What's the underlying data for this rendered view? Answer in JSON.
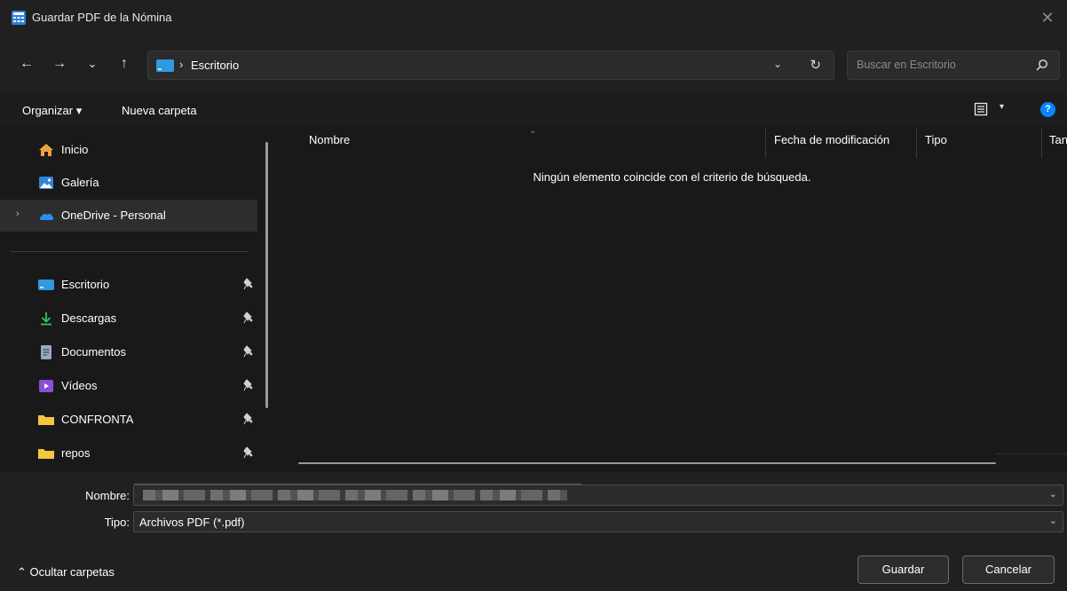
{
  "window": {
    "title": "Guardar PDF de la Nómina",
    "close_glyph": "✕"
  },
  "nav": {
    "back_glyph": "←",
    "forward_glyph": "→",
    "recent_glyph": "⌄",
    "up_glyph": "↑",
    "address_separator": "›",
    "address_path": "Escritorio",
    "address_dropdown_glyph": "⌄",
    "refresh_glyph": "↻",
    "search_placeholder": "Buscar en Escritorio"
  },
  "commands": {
    "organize": "Organizar ▾",
    "new_folder": "Nueva carpeta",
    "view_caret": "▾",
    "help": "?"
  },
  "sidebar": {
    "items": [
      {
        "label": "Inicio",
        "icon": "home-icon"
      },
      {
        "label": "Galería",
        "icon": "gallery-icon"
      },
      {
        "label": "OneDrive - Personal",
        "icon": "onedrive-icon",
        "expand_glyph": "›",
        "selected": true
      },
      {
        "label": "Escritorio",
        "icon": "desktop-folder-icon",
        "pinned": true
      },
      {
        "label": "Descargas",
        "icon": "download-icon",
        "pinned": true
      },
      {
        "label": "Documentos",
        "icon": "documents-icon",
        "pinned": true
      },
      {
        "label": "Vídeos",
        "icon": "videos-icon",
        "pinned": true
      },
      {
        "label": "CONFRONTA",
        "icon": "folder-icon",
        "pinned": true
      },
      {
        "label": "repos",
        "icon": "folder-icon",
        "pinned": true
      }
    ]
  },
  "filelist": {
    "columns": [
      "Nombre",
      "Fecha de modificación",
      "Tipo",
      "Tan"
    ],
    "sort_caret": "⌄",
    "empty_message": "Ningún elemento coincide con el criterio de búsqueda."
  },
  "form": {
    "name_label": "Nombre:",
    "name_value": "",
    "name_caret": "⌄",
    "type_label": "Tipo:",
    "type_value": "Archivos PDF (*.pdf)",
    "type_caret": "⌄"
  },
  "footer": {
    "hide_folders": "⌃  Ocultar carpetas",
    "save_button": "Guardar",
    "cancel_button": "Cancelar"
  },
  "colors": {
    "accent": "#0a84ff",
    "folder": "#f5c542",
    "desktop": "#2f9ae0"
  }
}
